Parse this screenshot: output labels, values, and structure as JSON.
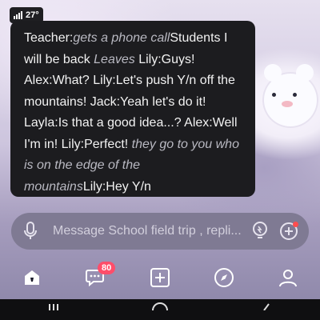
{
  "status_bar": {
    "time": "27°"
  },
  "message": {
    "segments": [
      {
        "text": "Teacher:",
        "style": "normal"
      },
      {
        "text": "gets a phone call",
        "style": "action"
      },
      {
        "text": "Students I will be back ",
        "style": "normal"
      },
      {
        "text": "Leaves",
        "style": "action"
      },
      {
        "text": " Lily:Guys! Alex:What? Lily:Let's push Y/n off the mountains! Jack:Yeah let's do it! Layla:Is that a good idea...? Alex:Well I'm in! Lily:Perfect! ",
        "style": "normal"
      },
      {
        "text": "they go to you who is on the edge of the mountains",
        "style": "action"
      },
      {
        "text": "Lily:Hey Y/n",
        "style": "normal"
      }
    ]
  },
  "composer": {
    "placeholder": "Message School field trip , repli..."
  },
  "bottom_nav": {
    "items": [
      {
        "name": "home-icon"
      },
      {
        "name": "chat-icon",
        "badge": "80"
      },
      {
        "name": "create-icon"
      },
      {
        "name": "explore-icon"
      },
      {
        "name": "profile-icon"
      }
    ]
  },
  "icons": {
    "mic": "microphone-icon",
    "bulb": "lightbulb-icon",
    "add": "plus-circle-icon"
  },
  "colors": {
    "bubble": "#1c1c1f",
    "composer": "#7f7a93",
    "badge": "#ff4d6a",
    "action_text": "#b9b9c2"
  }
}
